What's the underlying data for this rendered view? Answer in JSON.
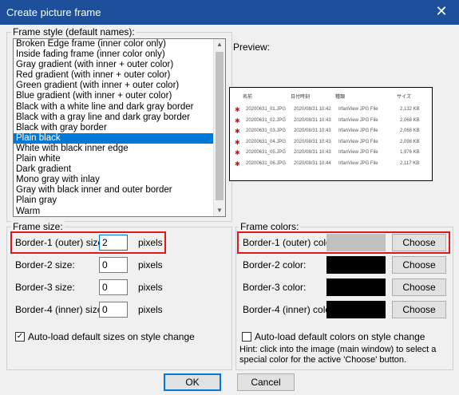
{
  "window": {
    "title": "Create picture frame",
    "close_glyph": "✕"
  },
  "frame_style": {
    "group_label": "Frame style (default names):",
    "items": [
      "Broken Edge frame (inner color only)",
      "Inside fading frame (inner color only)",
      "Gray gradient (with inner + outer color)",
      "Red gradient (with inner + outer color)",
      "Green gradient (with inner + outer color)",
      "Blue gradient (with inner + outer color)",
      "Black with a white line and dark gray border",
      "Black with a gray line and dark gray border",
      "Black with gray border",
      "Plain black",
      "White with black inner edge",
      "Plain white",
      "Dark gradient",
      "Mono gray with inlay",
      "Gray with black inner and outer border",
      "Plain gray",
      "Warm"
    ],
    "selected_item": "Plain black"
  },
  "preview": {
    "label": "Preview:",
    "headers": [
      "名前",
      "日付時刻",
      "種類",
      "サイズ"
    ],
    "rows": [
      [
        "20200631_01.JPG",
        "2020/08/31 10:42",
        "IrfanView JPG File",
        "2,132 KB"
      ],
      [
        "20200631_02.JPG",
        "2020/08/31 10:43",
        "IrfanView JPG File",
        "2,068 KB"
      ],
      [
        "20200631_03.JPG",
        "2020/08/31 10:43",
        "IrfanView JPG File",
        "2,068 KB"
      ],
      [
        "20200631_04.JPG",
        "2020/08/31 10:43",
        "IrfanView JPG File",
        "2,098 KB"
      ],
      [
        "20200631_05.JPG",
        "2020/08/31 10:43",
        "IrfanView JPG File",
        "1,976 KB"
      ],
      [
        "20200631_06.JPG",
        "2020/08/31 10:44",
        "IrfanView JPG File",
        "2,117 KB"
      ]
    ]
  },
  "frame_size": {
    "group_label": "Frame size:",
    "border1_label": "Border-1 (outer) size:",
    "border1_value": "2",
    "border2_label": "Border-2 size:",
    "border2_value": "0",
    "border3_label": "Border-3 size:",
    "border3_value": "0",
    "border4_label": "Border-4 (inner) size:",
    "border4_value": "0",
    "units": "pixels",
    "autoload_label": "Auto-load default sizes on style change",
    "autoload_checked": true
  },
  "frame_colors": {
    "group_label": "Frame colors:",
    "border1_label": "Border-1 (outer) color:",
    "border1_color": "#c0c0c0",
    "border2_label": "Border-2 color:",
    "border2_color": "#000000",
    "border3_label": "Border-3 color:",
    "border3_color": "#000000",
    "border4_label": "Border-4 (inner) color:",
    "border4_color": "#000000",
    "choose_label": "Choose",
    "autoload_label": "Auto-load default colors on style change",
    "autoload_checked": false,
    "hint": "Hint: click into the image (main window) to select a special color for the active 'Choose' button."
  },
  "footer": {
    "ok_label": "OK",
    "cancel_label": "Cancel"
  }
}
